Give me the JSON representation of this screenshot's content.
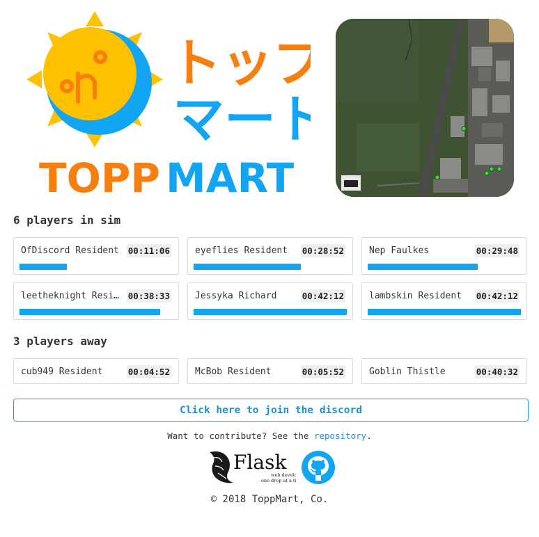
{
  "logo": {
    "katakana_line1": "トップ",
    "katakana_line2": "マート",
    "wordmark_left": "TOPP",
    "wordmark_right": "MART",
    "colors": {
      "orange": "#f77f0f",
      "blue": "#12a5f4",
      "yellow": "#ffc100"
    }
  },
  "present": {
    "title": "6 players in sim",
    "players": [
      {
        "name": "OfDiscord Resident",
        "time": "00:11:06",
        "progress": 0.31
      },
      {
        "name": "eyeflies Resident",
        "time": "00:28:52",
        "progress": 0.7
      },
      {
        "name": "Nep Faulkes",
        "time": "00:29:48",
        "progress": 0.72
      },
      {
        "name": "leetheknight Resident",
        "time": "00:38:33",
        "progress": 0.92
      },
      {
        "name": "Jessyka Richard",
        "time": "00:42:12",
        "progress": 1.0
      },
      {
        "name": "lambskin Resident",
        "time": "00:42:12",
        "progress": 1.0
      }
    ]
  },
  "away": {
    "title": "3 players away",
    "players": [
      {
        "name": "cub949 Resident",
        "time": "00:04:52"
      },
      {
        "name": "McBob Resident",
        "time": "00:05:52"
      },
      {
        "name": "Goblin Thistle",
        "time": "00:40:32"
      }
    ]
  },
  "discord_button": "Click here to join the discord",
  "contribute": {
    "prefix": "Want to contribute? See the ",
    "link": "repository",
    "suffix": "."
  },
  "flask_logo": {
    "name": "Flask",
    "tagline_1": "web development,",
    "tagline_2": "one drop at a time"
  },
  "footer": "© 2018 ToppMart, Co.",
  "accent_color": "#12a5f4"
}
